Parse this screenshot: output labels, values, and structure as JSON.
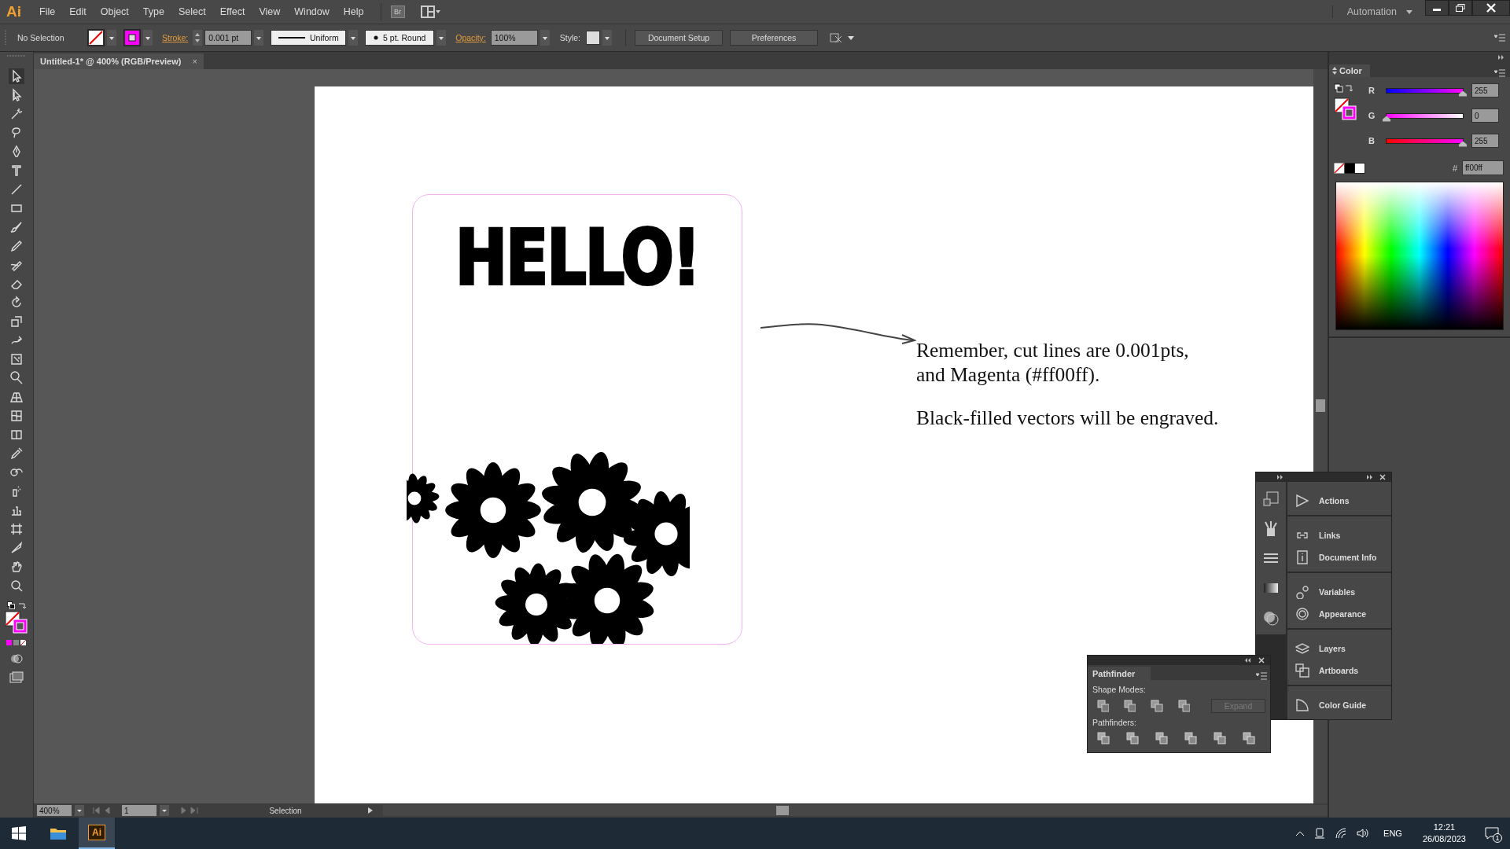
{
  "app": {
    "logo": "Ai",
    "bridge": "Br",
    "workspace": "Automation"
  },
  "menu": [
    "File",
    "Edit",
    "Object",
    "Type",
    "Select",
    "Effect",
    "View",
    "Window",
    "Help"
  ],
  "control_bar": {
    "selection": "No Selection",
    "stroke_label": "Stroke:",
    "stroke_weight": "0.001 pt",
    "profile": "Uniform",
    "brush": "5 pt. Round",
    "opacity_label": "Opacity:",
    "opacity": "100%",
    "style_label": "Style:",
    "buttons": [
      "Document Setup",
      "Preferences"
    ]
  },
  "document_tab": {
    "title": "Untitled-1* @ 400% (RGB/Preview)",
    "close": "×"
  },
  "artboard": {
    "headline": "HELLO!",
    "note": [
      [
        "Remember, cut lines are 0.001pts,",
        "and Magenta (#ff00ff)."
      ],
      [
        "Black-filled vectors will be engraved."
      ]
    ]
  },
  "color_panel": {
    "title": "Color",
    "channels": [
      {
        "name": "R",
        "value": "255",
        "level": 1
      },
      {
        "name": "G",
        "value": "0",
        "level": 0
      },
      {
        "name": "B",
        "value": "255",
        "level": 1
      }
    ],
    "hex_label": "#",
    "hex": "ff00ff"
  },
  "panel_dock": {
    "groups": [
      {
        "items": [
          "Actions"
        ]
      },
      {
        "items": [
          "Links",
          "Document Info"
        ]
      },
      {
        "items": [
          "Variables",
          "Appearance"
        ]
      },
      {
        "items": [
          "Layers",
          "Artboards"
        ]
      },
      {
        "items": [
          "Color Guide"
        ]
      }
    ]
  },
  "pathfinder": {
    "title": "Pathfinder",
    "shape_modes_label": "Shape Modes:",
    "expand": "Expand",
    "expand_disabled": true,
    "pathfinders_label": "Pathfinders:"
  },
  "status_bar": {
    "zoom": "400%",
    "artboard_number": "1",
    "tool": "Selection"
  },
  "taskbar": {
    "app": "Ai",
    "language": "ENG",
    "time": "12:21",
    "date": "26/08/2023",
    "notifications": "1"
  }
}
